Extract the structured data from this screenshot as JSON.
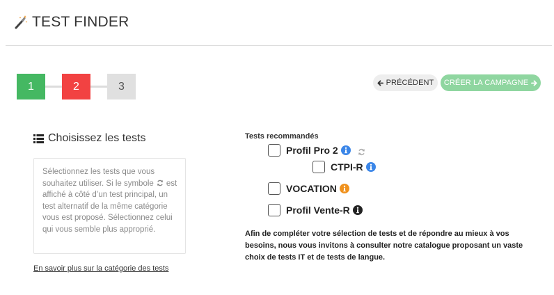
{
  "header": {
    "icon": "magic-wand-icon",
    "title": "TEST FINDER"
  },
  "stepper": {
    "steps": [
      {
        "label": "1",
        "status": "done",
        "color": "#45b862"
      },
      {
        "label": "2",
        "status": "current",
        "color": "#f24242"
      },
      {
        "label": "3",
        "status": "pending",
        "color": "#e0e0e0"
      }
    ]
  },
  "actions": {
    "prev_label": "PRÉCÉDENT",
    "prev_icon": "arrow-left-icon",
    "create_label": "CRÉER LA CAMPAGNE",
    "create_icon": "arrow-right-icon",
    "create_enabled": false,
    "create_color": "#8fd6a0"
  },
  "left_panel": {
    "title_icon": "list-icon",
    "title": "Choisissez les tests",
    "help_text_before": "Sélectionnez les tests que vous souhaitez utiliser. Si le symbole",
    "help_icon": "refresh-icon",
    "help_text_after": "est affiché à côté d’un test principal, un test alternatif de la même catégorie vous est proposé. Sélectionnez celui qui vous semble plus approprié.",
    "learn_more_link": "En savoir plus sur la catégorie des tests"
  },
  "tests": {
    "section_label": "Tests recommandés",
    "items": [
      {
        "name": "Profil Pro 2",
        "checked": false,
        "info_color": "#3b86e8",
        "has_alternative": true
      },
      {
        "name": "CTPI-R",
        "checked": false,
        "info_color": "#3b86e8",
        "has_alternative": false
      },
      {
        "name": "VOCATION",
        "checked": false,
        "info_color": "#f0921e",
        "has_alternative": false
      },
      {
        "name": "Profil Vente-R",
        "checked": false,
        "info_color": "#222222",
        "has_alternative": false
      }
    ],
    "footer": "Afin de compléter votre sélection de tests et de répondre au mieux à vos besoins, nous vous invitons à consulter notre catalogue proposant un vaste choix de tests IT et de tests de langue."
  }
}
